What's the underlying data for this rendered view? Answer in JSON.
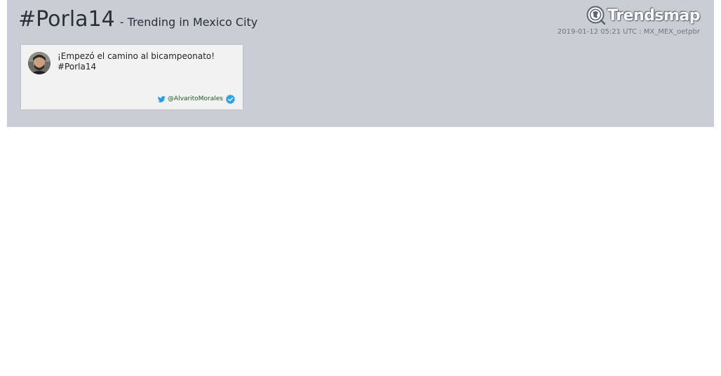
{
  "header": {
    "hashtag": "#Porla14",
    "subtitle": "- Trending in Mexico City",
    "brand": "Trendsmap",
    "meta": "2019-01-12 05:21 UTC : MX_MEX_oetpbr"
  },
  "tweet": {
    "line1": "¡Empezó el camino al bicampeonato!",
    "line2": "#Porla14",
    "handle": "@AlvaritoMorales"
  },
  "colors": {
    "panel_bg": "#cbcdd5",
    "card_bg": "#f2f2f2",
    "twitter_blue": "#1da1f2",
    "verified_blue": "#2aa3ef",
    "handle_green": "#1d5b27"
  },
  "icons": {
    "brand": "trendsmap-globe-icon",
    "twitter": "twitter-bird-icon",
    "verified": "verified-check-icon"
  }
}
